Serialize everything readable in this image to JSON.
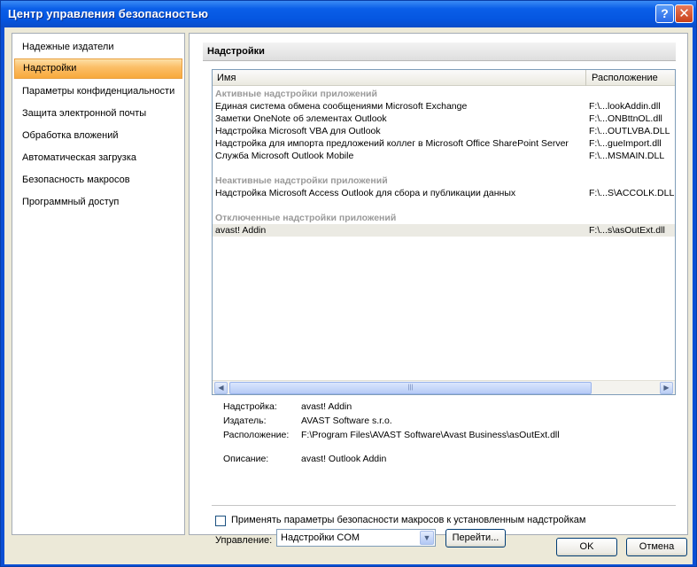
{
  "window": {
    "title": "Центр управления безопасностью",
    "help_label": "?",
    "close_label": "✕"
  },
  "nav": {
    "items": [
      {
        "label": "Надежные издатели"
      },
      {
        "label": "Надстройки"
      },
      {
        "label": "Параметры конфиденциальности"
      },
      {
        "label": "Защита электронной почты"
      },
      {
        "label": "Обработка вложений"
      },
      {
        "label": "Автоматическая загрузка"
      },
      {
        "label": "Безопасность макросов"
      },
      {
        "label": "Программный доступ"
      }
    ],
    "selected": "Надстройки"
  },
  "panel": {
    "header": "Надстройки",
    "columns": {
      "name": "Имя",
      "location": "Расположение"
    },
    "groups": [
      {
        "title": "Активные надстройки приложений",
        "items": [
          {
            "name": "Единая система обмена сообщениями Microsoft Exchange",
            "location": "F:\\...lookAddin.dll"
          },
          {
            "name": "Заметки OneNote об элементах Outlook",
            "location": "F:\\...ONBttnOL.dll"
          },
          {
            "name": "Надстройка Microsoft VBA для Outlook",
            "location": "F:\\...OUTLVBA.DLL"
          },
          {
            "name": "Надстройка для импорта предложений коллег в Microsoft Office SharePoint Server",
            "location": "F:\\...gueImport.dll"
          },
          {
            "name": "Служба Microsoft Outlook Mobile",
            "location": "F:\\...MSMAIN.DLL"
          }
        ]
      },
      {
        "title": "Неактивные надстройки приложений",
        "items": [
          {
            "name": "Надстройка Microsoft Access Outlook для сбора и публикации данных",
            "location": "F:\\...S\\ACCOLK.DLL"
          }
        ]
      },
      {
        "title": "Отключенные надстройки приложений",
        "items": [
          {
            "name": "avast! Addin",
            "location": "F:\\...s\\asOutExt.dll"
          }
        ]
      }
    ],
    "scroll": {
      "left": "◀",
      "right": "▶",
      "grip": "|||"
    },
    "details": {
      "addin_label": "Надстройка:",
      "addin_value": "avast! Addin",
      "publisher_label": "Издатель:",
      "publisher_value": "AVAST Software s.r.o.",
      "location_label": "Расположение:",
      "location_value": "F:\\Program Files\\AVAST Software\\Avast Business\\asOutExt.dll",
      "description_label": "Описание:",
      "description_value": "avast! Outlook Addin"
    },
    "apply_macro_checkbox": {
      "label": "Применять параметры безопасности макросов к установленным надстройкам",
      "checked": false
    },
    "manage": {
      "label": "Управление:",
      "selected": "Надстройки COM",
      "dropdown_arrow": "▼",
      "go_label": "Перейти..."
    }
  },
  "footer": {
    "ok_label": "OK",
    "cancel_label": "Отмена"
  }
}
